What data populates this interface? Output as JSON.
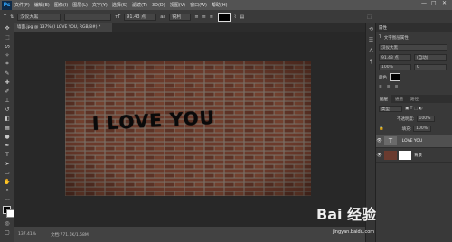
{
  "menu": {
    "logo": "Ps",
    "items": [
      "文件(F)",
      "编辑(E)",
      "图像(I)",
      "图层(L)",
      "文字(Y)",
      "选择(S)",
      "滤镜(T)",
      "3D(D)",
      "视图(V)",
      "窗口(W)",
      "帮助(H)"
    ],
    "window_controls": [
      "—",
      "□",
      "✕"
    ]
  },
  "options": {
    "tool_glyph": "T",
    "font_family": "汉仪大黑",
    "font_size": "91.43 点",
    "antialias": "锐利"
  },
  "document_tab": {
    "title": "墙面.jpg @ 137% (I LOVE YOU, RGB/8#) *"
  },
  "canvas": {
    "headline": "I LOVE YOU"
  },
  "status": {
    "zoom": "137.41%",
    "info": "文档:771.1K/1.58M"
  },
  "panel": {
    "header": "属性",
    "subheader": "文字图层属性",
    "font": "汉仪大黑",
    "size": "91.43 点",
    "leading": "(自动)",
    "scale": "100%",
    "tracking": "0",
    "color_label": "颜色",
    "color_hex": "#000000"
  },
  "layers": {
    "tabs": [
      "图层",
      "通道",
      "路径"
    ],
    "kind": "类型",
    "opacity_label": "不透明度:",
    "opacity_value": "100%",
    "fill_label": "填充:",
    "fill_value": "100%",
    "items": [
      {
        "name": "I LOVE YOU",
        "type": "text",
        "selected": true
      },
      {
        "name": "背景",
        "type": "image",
        "selected": false
      }
    ]
  },
  "watermark": {
    "text": "Bai 经验",
    "sub": "jingyan.baidu.com"
  },
  "icons": [
    "move-tool-icon",
    "marquee-tool-icon",
    "lasso-tool-icon",
    "magic-wand-icon",
    "crop-tool-icon",
    "eyedropper-icon",
    "healing-brush-icon",
    "brush-tool-icon",
    "clone-stamp-icon",
    "eraser-icon",
    "gradient-tool-icon",
    "dodge-tool-icon",
    "pen-tool-icon",
    "type-tool-icon",
    "path-select-icon",
    "shape-tool-icon",
    "hand-tool-icon",
    "zoom-tool-icon",
    "eye-icon",
    "lock-icon"
  ]
}
